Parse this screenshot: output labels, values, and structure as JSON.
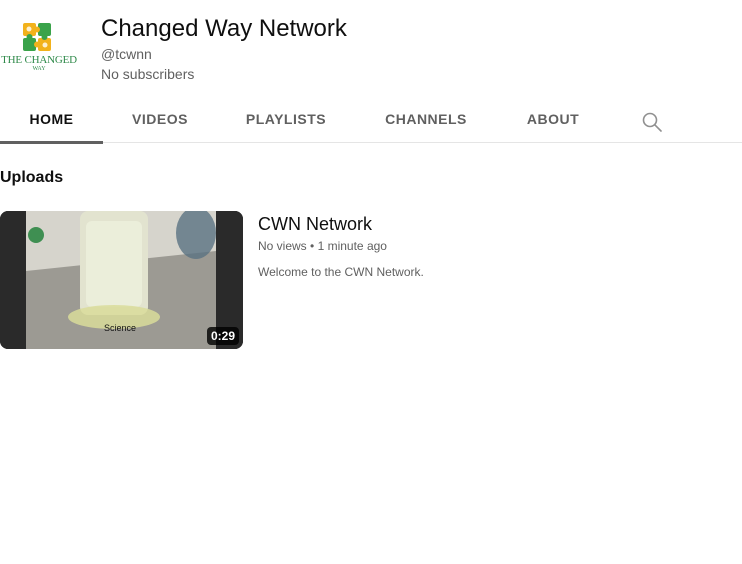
{
  "channel": {
    "logo_text": "THE CHANGED",
    "logo_subtext": "WAY",
    "title": "Changed Way Network",
    "handle": "@tcwnn",
    "subscribers": "No subscribers"
  },
  "tabs": [
    {
      "label": "HOME",
      "active": true
    },
    {
      "label": "VIDEOS",
      "active": false
    },
    {
      "label": "PLAYLISTS",
      "active": false
    },
    {
      "label": "CHANNELS",
      "active": false
    },
    {
      "label": "ABOUT",
      "active": false
    }
  ],
  "search_icon": "search-icon",
  "uploads": {
    "section_title": "Uploads",
    "videos": [
      {
        "title": "CWN Network",
        "views": "No views",
        "separator": "•",
        "age": "1 minute ago",
        "description": "Welcome to the CWN Network.",
        "duration": "0:29",
        "thumbnail_caption": "Science"
      }
    ]
  },
  "colors": {
    "text_primary": "#0f0f0f",
    "text_secondary": "#606060",
    "logo_green": "#2f8a4a"
  }
}
